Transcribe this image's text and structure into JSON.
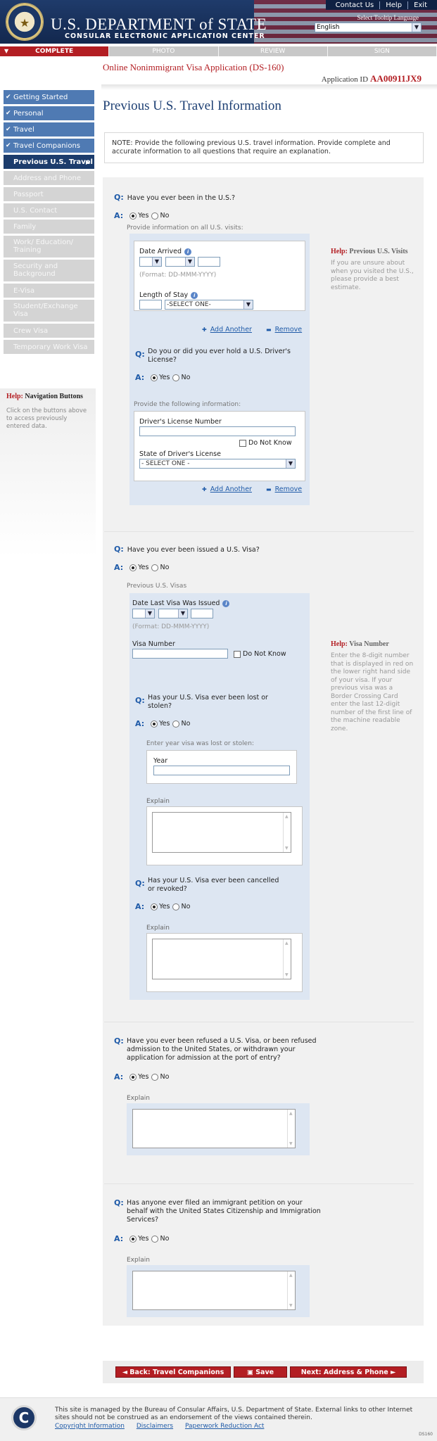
{
  "header": {
    "title": "U.S. DEPARTMENT of STATE",
    "subtitle": "CONSULAR ELECTRONIC APPLICATION CENTER",
    "top_links": [
      "Contact Us",
      "Help",
      "Exit"
    ],
    "language_label": "Select Tooltip Language",
    "language_value": "English"
  },
  "progress": [
    "COMPLETE",
    "PHOTO",
    "REVIEW",
    "SIGN"
  ],
  "form_title": "Online Nonimmigrant Visa Application (DS-160)",
  "application_id_label": "Application ID",
  "application_id": "AA00911JX9",
  "page_title": "Previous U.S. Travel Information",
  "note": "NOTE: Provide the following previous U.S. travel information. Provide complete and accurate information to all questions that require an explanation.",
  "sidebar": {
    "items": [
      {
        "label": "Getting Started",
        "state": "done"
      },
      {
        "label": "Personal",
        "state": "done"
      },
      {
        "label": "Travel",
        "state": "done"
      },
      {
        "label": "Travel Companions",
        "state": "done"
      },
      {
        "label": "Previous U.S. Travel",
        "state": "current"
      },
      {
        "label": "Address and Phone",
        "state": "todo"
      },
      {
        "label": "Passport",
        "state": "todo"
      },
      {
        "label": "U.S. Contact",
        "state": "todo"
      },
      {
        "label": "Family",
        "state": "todo"
      },
      {
        "label": "Work/ Education/ Training",
        "state": "todo"
      },
      {
        "label": "Security and Background",
        "state": "todo"
      },
      {
        "label": "E-Visa",
        "state": "todo"
      },
      {
        "label": "Student/Exchange Visa",
        "state": "todo"
      },
      {
        "label": "Crew Visa",
        "state": "todo"
      },
      {
        "label": "Temporary Work Visa",
        "state": "todo"
      }
    ],
    "help_title_red": "Help:",
    "help_title": "Navigation Buttons",
    "help_text": "Click on the buttons above to access previously entered data."
  },
  "common": {
    "q": "Q:",
    "a": "A:",
    "yes": "Yes",
    "no": "No",
    "add_another": "Add Another",
    "remove": "Remove",
    "format": "(Format: DD-MMM-YYYY)",
    "do_not_know": "Do Not Know",
    "select_one": "-SELECT ONE-",
    "select_one_spaced": "- SELECT ONE -",
    "explain": "Explain",
    "help_label": "Help:"
  },
  "q1": {
    "question": "Have you ever been in the U.S.?",
    "sub_label": "Provide information on all U.S. visits:",
    "date_arrived": "Date Arrived",
    "length_of_stay": "Length of Stay",
    "help_title": "Previous U.S. Visits",
    "help_text": "If you are unsure about when you visited the U.S., please provide a best estimate."
  },
  "q1b": {
    "question": "Do you or did you ever hold a U.S. Driver's License?",
    "sub_label": "Provide the following information:",
    "license_number": "Driver's License Number",
    "license_state": "State of Driver's License"
  },
  "q2": {
    "question": "Have you ever been issued a U.S. Visa?",
    "sub_label": "Previous U.S. Visas",
    "date_last_visa": "Date Last Visa Was Issued",
    "visa_number": "Visa Number",
    "help_title": "Visa Number",
    "help_text": "Enter the 8-digit number that is displayed in red on the lower right hand side of your visa. If your previous visa was a Border Crossing Card enter the last 12-digit number of the first line of the machine readable zone."
  },
  "q2b": {
    "question": "Has your U.S. Visa ever been lost or stolen?",
    "sub_label": "Enter year visa was lost or stolen:",
    "year": "Year"
  },
  "q2c": {
    "question": "Has your U.S. Visa ever been cancelled or revoked?"
  },
  "q3": {
    "question": "Have you ever been refused a U.S. Visa, or been refused admission to the United States, or withdrawn your application for admission at the port of entry?"
  },
  "q4": {
    "question": "Has anyone ever filed an immigrant petition on your behalf with the United States Citizenship and Immigration Services?"
  },
  "buttons": {
    "back": "◄ Back: Travel Companions",
    "save": "Save",
    "next": "Next: Address & Phone ►"
  },
  "footer": {
    "text": "This site is managed by the Bureau of Consular Affairs, U.S. Department of State. External links to other Internet sites should not be construed as an endorsement of the views contained therein.",
    "links": [
      "Copyright Information",
      "Disclaimers",
      "Paperwork Reduction Act"
    ],
    "code": "DS160"
  }
}
